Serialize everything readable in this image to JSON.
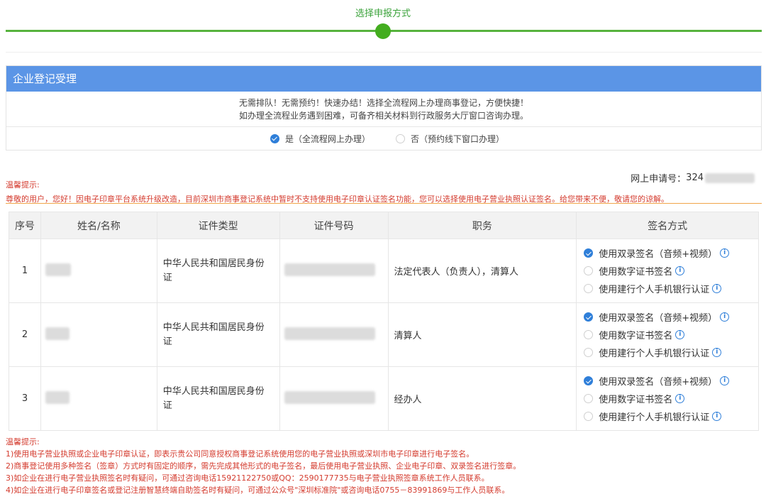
{
  "stepper": {
    "title": "选择申报方式"
  },
  "panel": {
    "title": "企业登记受理",
    "msg1": "无需排队！无需预约！快速办结！选择全流程网上办理商事登记，方便快捷！",
    "msg2": "如办理全流程业务遇到困难，可备齐相关材料到行政服务大厅窗口咨询办理。",
    "options": [
      {
        "label": "是（全流程网上办理）",
        "selected": true
      },
      {
        "label": "否（预约线下窗口办理）",
        "selected": false
      }
    ]
  },
  "notice_top": {
    "heading": "温馨提示:",
    "text": "尊敬的用户，您好！因电子印章平台系统升级改造，目前深圳市商事登记系统中暂时不支持使用电子印章认证签名功能，您可以选择使用电子营业执照认证签名。给您带来不便，敬请您的谅解。"
  },
  "application": {
    "label": "网上申请号：",
    "value_prefix": "324"
  },
  "table": {
    "headers": [
      "序号",
      "姓名/名称",
      "证件类型",
      "证件号码",
      "职务",
      "签名方式"
    ],
    "rows": [
      {
        "index": "1",
        "id_type": "中华人民共和国居民身份证",
        "role": "法定代表人（负责人），清算人"
      },
      {
        "index": "2",
        "id_type": "中华人民共和国居民身份证",
        "role": "清算人"
      },
      {
        "index": "3",
        "id_type": "中华人民共和国居民身份证",
        "role": "经办人"
      }
    ],
    "sign_options": [
      "使用双录签名（音频+视频）",
      "使用数字证书签名",
      "使用建行个人手机银行认证"
    ],
    "info_glyph": "i"
  },
  "notice_bottom": {
    "heading": "温馨提示:",
    "items": [
      "1)使用电子营业执照或企业电子印章认证，即表示贵公司同意授权商事登记系统使用您的电子营业执照或深圳市电子印章进行电子签名。",
      "2)商事登记使用多种签名（签章）方式时有固定的顺序，需先完成其他形式的电子签名，最后使用电子营业执照、企业电子印章、双录签名进行签章。",
      "3)如企业在进行电子营业执照签名时有疑问，可通过咨询电话15921122750或QQ：2590177735与电子营业执照签章系统工作人员联系。",
      "4)如企业在进行电子印章签名或登记注册智慧终端自助签名时有疑问，可通过公众号\"深圳标准院\"或咨询电话0755－83991869与工作人员联系。"
    ]
  },
  "colors": {
    "accent_green": "#43ad1f",
    "header_blue": "#5b95e6",
    "notice_red": "#d43b2e",
    "check_blue": "#2f7fd9"
  }
}
